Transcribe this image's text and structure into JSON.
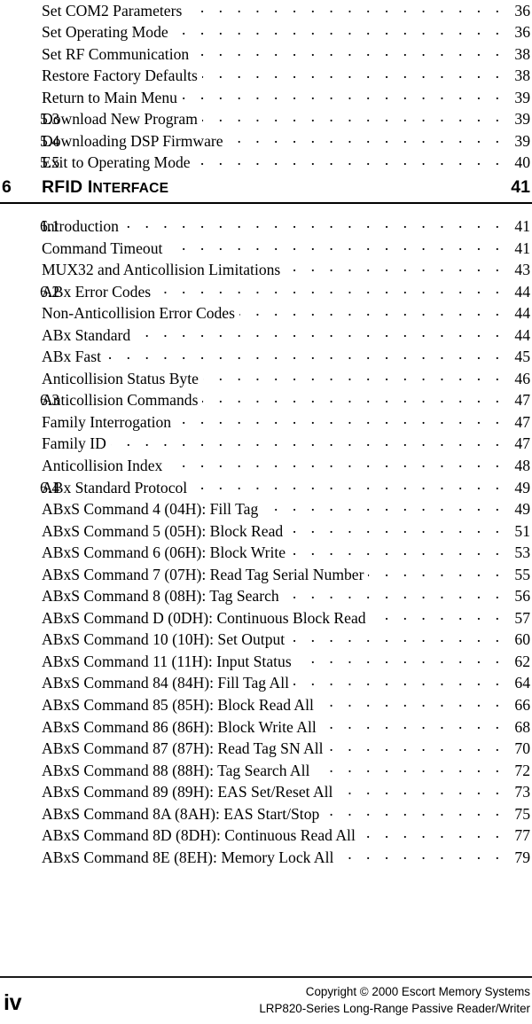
{
  "document": {
    "type": "table-of-contents",
    "folio": "iv"
  },
  "toc": {
    "entries": [
      {
        "number": "",
        "label": "Set COM2 Parameters",
        "page": "36",
        "level": 2
      },
      {
        "number": "",
        "label": "Set Operating Mode",
        "page": "36",
        "level": 2
      },
      {
        "number": "",
        "label": "Set RF Communication",
        "page": "38",
        "level": 2
      },
      {
        "number": "",
        "label": "Restore Factory Defaults",
        "page": "38",
        "level": 2
      },
      {
        "number": "",
        "label": "Return to Main Menu",
        "page": "39",
        "level": 2
      },
      {
        "number": "5.3",
        "label": "Download New Program",
        "page": "39",
        "level": 1
      },
      {
        "number": "5.4",
        "label": "Downloading DSP Firmware",
        "page": "39",
        "level": 1
      },
      {
        "number": "5.5",
        "label": "Exit to Operating Mode",
        "page": "40",
        "level": 1
      }
    ],
    "entries_after_chapter": [
      {
        "number": "6.1",
        "label": "Introduction",
        "page": "41",
        "level": 1
      },
      {
        "number": "",
        "label": "Command Timeout",
        "page": "41",
        "level": 2
      },
      {
        "number": "",
        "label": "MUX32 and Anticollision Limitations",
        "page": "43",
        "level": 2
      },
      {
        "number": "6.2",
        "label": "ABx Error Codes",
        "page": "44",
        "level": 1
      },
      {
        "number": "",
        "label": "Non-Anticollision Error Codes",
        "page": "44",
        "level": 2
      },
      {
        "number": "",
        "label": "ABx Standard",
        "page": "44",
        "level": 2
      },
      {
        "number": "",
        "label": "ABx Fast",
        "page": "45",
        "level": 2
      },
      {
        "number": "",
        "label": "Anticollision Status Byte",
        "page": "46",
        "level": 2
      },
      {
        "number": "6.3",
        "label": "Anticollision Commands",
        "page": "47",
        "level": 1
      },
      {
        "number": "",
        "label": "Family Interrogation",
        "page": "47",
        "level": 2
      },
      {
        "number": "",
        "label": "Family ID",
        "page": "47",
        "level": 2
      },
      {
        "number": "",
        "label": "Anticollision Index",
        "page": "48",
        "level": 2
      },
      {
        "number": "6.4",
        "label": "ABx Standard Protocol",
        "page": "49",
        "level": 1
      },
      {
        "number": "",
        "label": "ABxS Command 4 (04H): Fill Tag",
        "page": "49",
        "level": 2
      },
      {
        "number": "",
        "label": "ABxS Command 5 (05H): Block Read",
        "page": "51",
        "level": 2
      },
      {
        "number": "",
        "label": "ABxS Command 6 (06H): Block Write",
        "page": "53",
        "level": 2
      },
      {
        "number": "",
        "label": "ABxS Command 7 (07H): Read Tag Serial Number",
        "page": "55",
        "level": 2
      },
      {
        "number": "",
        "label": "ABxS Command 8 (08H): Tag Search",
        "page": "56",
        "level": 2
      },
      {
        "number": "",
        "label": "ABxS Command D (0DH): Continuous Block Read",
        "page": "57",
        "level": 2
      },
      {
        "number": "",
        "label": "ABxS Command 10 (10H): Set Output",
        "page": "60",
        "level": 2
      },
      {
        "number": "",
        "label": "ABxS Command 11 (11H): Input Status",
        "page": "62",
        "level": 2
      },
      {
        "number": "",
        "label": "ABxS Command 84 (84H): Fill Tag All",
        "page": "64",
        "level": 2
      },
      {
        "number": "",
        "label": "ABxS Command 85 (85H): Block Read All",
        "page": "66",
        "level": 2
      },
      {
        "number": "",
        "label": "ABxS Command 86 (86H): Block Write All",
        "page": "68",
        "level": 2
      },
      {
        "number": "",
        "label": "ABxS Command 87 (87H): Read Tag SN All",
        "page": "70",
        "level": 2
      },
      {
        "number": "",
        "label": "ABxS Command 88 (88H): Tag Search All",
        "page": "72",
        "level": 2
      },
      {
        "number": "",
        "label": "ABxS Command 89 (89H): EAS Set/Reset All",
        "page": "73",
        "level": 2
      },
      {
        "number": "",
        "label": "ABxS Command 8A (8AH): EAS Start/Stop",
        "page": "75",
        "level": 2
      },
      {
        "number": "",
        "label": "ABxS Command 8D (8DH): Continuous Read All",
        "page": "77",
        "level": 2
      },
      {
        "number": "",
        "label": "ABxS Command 8E (8EH): Memory Lock All",
        "page": "79",
        "level": 2
      }
    ]
  },
  "chapter_heading": {
    "number": "6",
    "title_lead": "RFID I",
    "title_smallcaps": "NTERFACE",
    "title_full": "RFID INTERFACE",
    "page": "41"
  },
  "footer": {
    "folio": "iv",
    "copyright_line1": "Copyright © 2000 Escort Memory Systems",
    "copyright_line2": "LRP820-Series Long-Range Passive Reader/Writer"
  }
}
